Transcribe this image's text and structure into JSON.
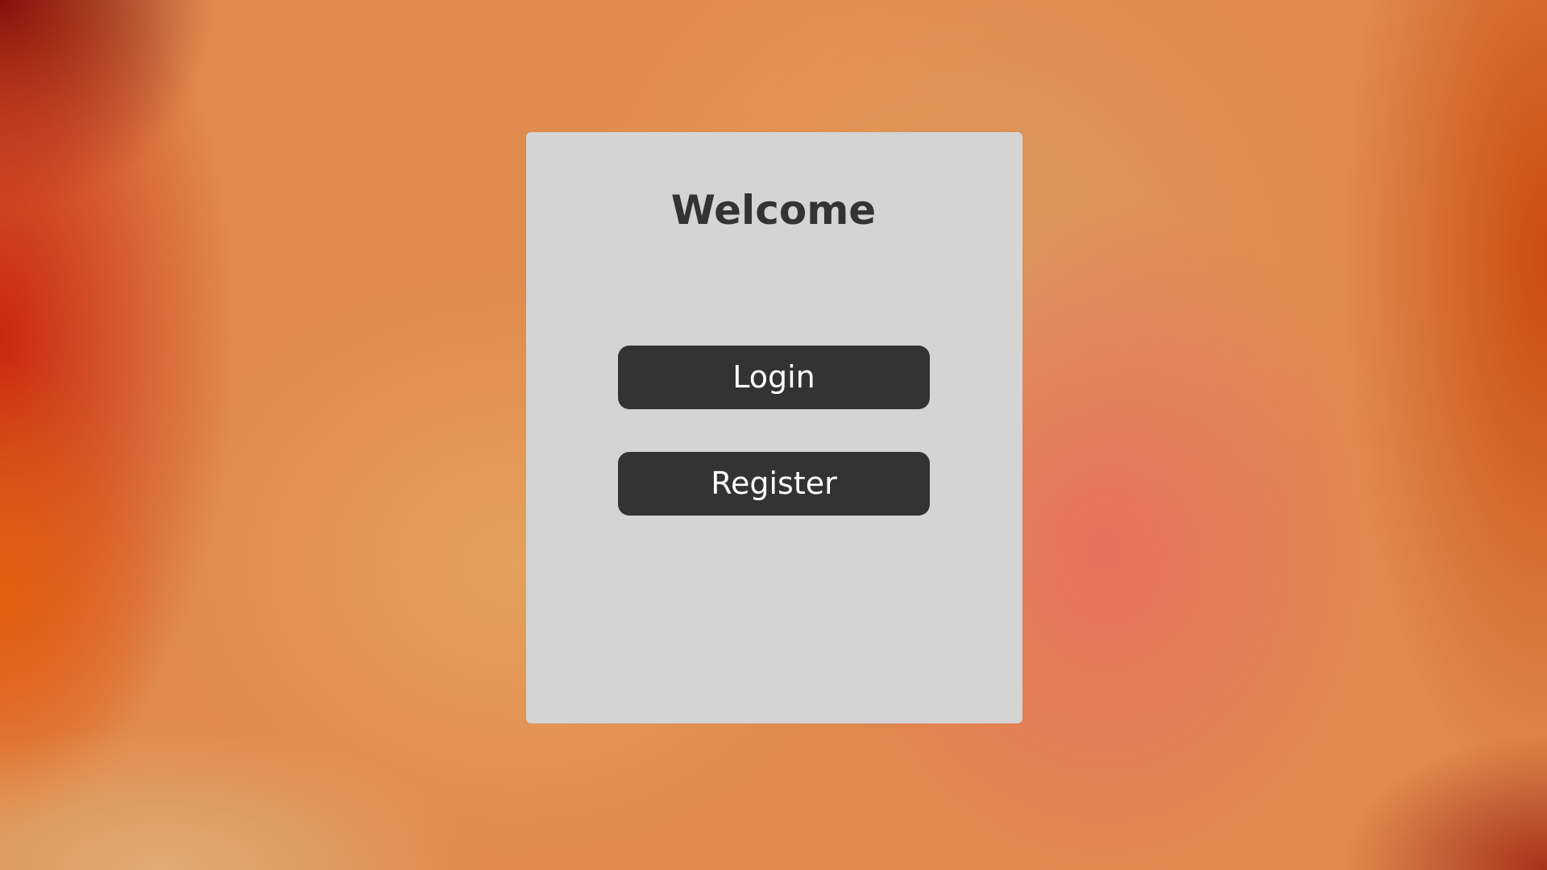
{
  "card": {
    "title": "Welcome"
  },
  "actions": {
    "login_label": "Login",
    "register_label": "Register"
  },
  "colors": {
    "card_background": "#d4d4d4",
    "button_background": "#333333",
    "button_text": "#ffffff",
    "title_text": "#333333",
    "page_accent": "#e08a4e"
  }
}
